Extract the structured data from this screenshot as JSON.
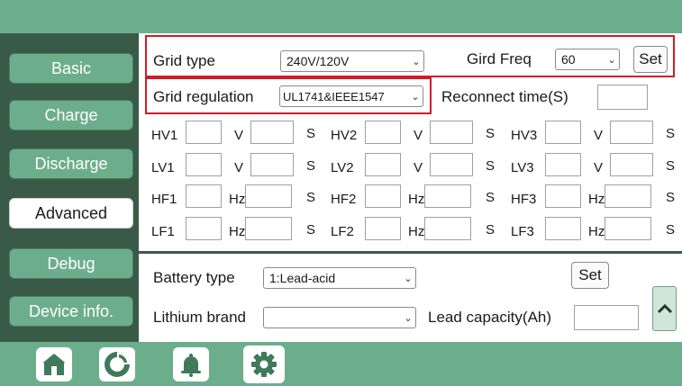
{
  "sidebar": {
    "items": [
      {
        "label": "Basic"
      },
      {
        "label": "Charge"
      },
      {
        "label": "Discharge"
      },
      {
        "label": "Advanced"
      },
      {
        "label": "Debug"
      },
      {
        "label": "Device info."
      }
    ],
    "active": "Advanced"
  },
  "grid": {
    "type_label": "Grid type",
    "type_value": "240V/120V",
    "freq_label": "Gird Freq",
    "freq_value": "60",
    "set_label": "Set",
    "regulation_label": "Grid regulation",
    "regulation_value": "UL1741&IEEE1547",
    "reconnect_label": "Reconnect time(S)",
    "reconnect_value": ""
  },
  "protection_rows": [
    {
      "groups": [
        {
          "name": "HV1",
          "unit": "V",
          "sec": "S"
        },
        {
          "name": "HV2",
          "unit": "V",
          "sec": "S"
        },
        {
          "name": "HV3",
          "unit": "V",
          "sec": "S"
        }
      ]
    },
    {
      "groups": [
        {
          "name": "LV1",
          "unit": "V",
          "sec": "S"
        },
        {
          "name": "LV2",
          "unit": "V",
          "sec": "S"
        },
        {
          "name": "LV3",
          "unit": "V",
          "sec": "S"
        }
      ]
    },
    {
      "groups": [
        {
          "name": "HF1",
          "unit": "Hz",
          "sec": "S"
        },
        {
          "name": "HF2",
          "unit": "Hz",
          "sec": "S"
        },
        {
          "name": "HF3",
          "unit": "Hz",
          "sec": "S"
        }
      ]
    },
    {
      "groups": [
        {
          "name": "LF1",
          "unit": "Hz",
          "sec": "S"
        },
        {
          "name": "LF2",
          "unit": "Hz",
          "sec": "S"
        },
        {
          "name": "LF3",
          "unit": "Hz",
          "sec": "S"
        }
      ]
    }
  ],
  "battery": {
    "type_label": "Battery type",
    "type_value": "1:Lead-acid",
    "set_label": "Set",
    "lithium_label": "Lithium brand",
    "lithium_value": "",
    "lead_capacity_label": "Lead capacity(Ah)",
    "lead_capacity_value": ""
  },
  "bottom_nav": {
    "items": [
      "home-icon",
      "chart-icon",
      "bell-icon",
      "settings-icon"
    ],
    "active": "settings-icon"
  },
  "colors": {
    "accent": "#6cae8b",
    "dark": "#3a5a48",
    "highlight": "#d21a2a"
  }
}
